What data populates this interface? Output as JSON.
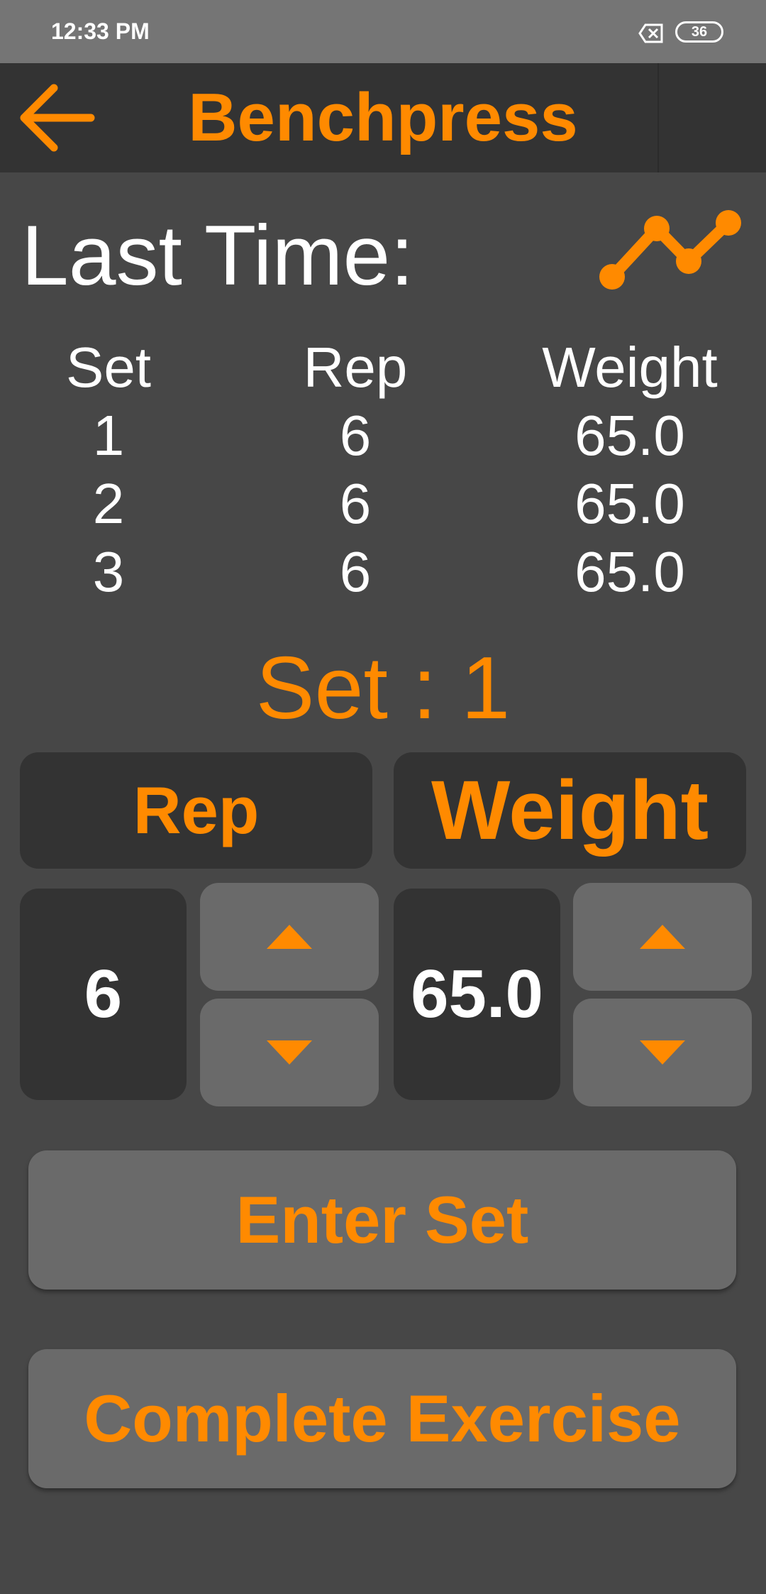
{
  "status_bar": {
    "time": "12:33 PM",
    "battery": "36"
  },
  "app_bar": {
    "title": "Benchpress",
    "back_icon": "arrow-left-icon"
  },
  "last_time": {
    "heading": "Last Time:",
    "graph_icon": "line-chart-icon",
    "columns": [
      "Set",
      "Rep",
      "Weight"
    ],
    "rows": [
      [
        "1",
        "6",
        "65.0"
      ],
      [
        "2",
        "6",
        "65.0"
      ],
      [
        "3",
        "6",
        "65.0"
      ]
    ]
  },
  "current": {
    "set_label": "Set : 1",
    "rep_header": "Rep",
    "weight_header": "Weight",
    "rep_value": "6",
    "weight_value": "65.0"
  },
  "actions": {
    "enter_set": "Enter Set",
    "complete_exercise": "Complete Exercise"
  },
  "colors": {
    "accent": "#ff8a00",
    "background": "#474747",
    "panel": "#333333",
    "button": "#6a6a6a"
  }
}
